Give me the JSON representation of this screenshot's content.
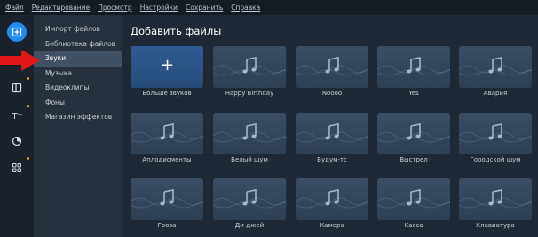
{
  "menu": [
    "Файл",
    "Редактирование",
    "Просмотр",
    "Настройки",
    "Сохранить",
    "Справка"
  ],
  "categories": [
    {
      "label": "Импорт файлов",
      "active": false
    },
    {
      "label": "Библиотека файлов",
      "active": false
    },
    {
      "label": "Звуки",
      "active": true
    },
    {
      "label": "Музыка",
      "active": false
    },
    {
      "label": "Видеоклипы",
      "active": false
    },
    {
      "label": "Фоны",
      "active": false
    },
    {
      "label": "Магазин эффектов",
      "active": false
    }
  ],
  "heading": "Добавить файлы",
  "tiles": [
    {
      "label": "Больше звуков",
      "type": "add",
      "glyph": "+"
    },
    {
      "label": "Happy Birthday",
      "type": "sound"
    },
    {
      "label": "Noooo",
      "type": "sound"
    },
    {
      "label": "Yes",
      "type": "sound"
    },
    {
      "label": "Авария",
      "type": "sound"
    },
    {
      "label": "Аплодисменты",
      "type": "sound"
    },
    {
      "label": "Белый шум",
      "type": "sound"
    },
    {
      "label": "Будум-тс",
      "type": "sound"
    },
    {
      "label": "Выстрел",
      "type": "sound"
    },
    {
      "label": "Городской шум",
      "type": "sound"
    },
    {
      "label": "Гроза",
      "type": "sound"
    },
    {
      "label": "Ди-джей",
      "type": "sound"
    },
    {
      "label": "Камера",
      "type": "sound"
    },
    {
      "label": "Касса",
      "type": "sound"
    },
    {
      "label": "Клавиатура",
      "type": "sound"
    }
  ],
  "tools": [
    "import-icon",
    "transitions-icon",
    "titles-icon",
    "filters-icon",
    "more-tools-icon"
  ],
  "colors": {
    "accent": "#1f8cf0",
    "callout_arrow": "#e01818",
    "badge": "#f3b400"
  }
}
